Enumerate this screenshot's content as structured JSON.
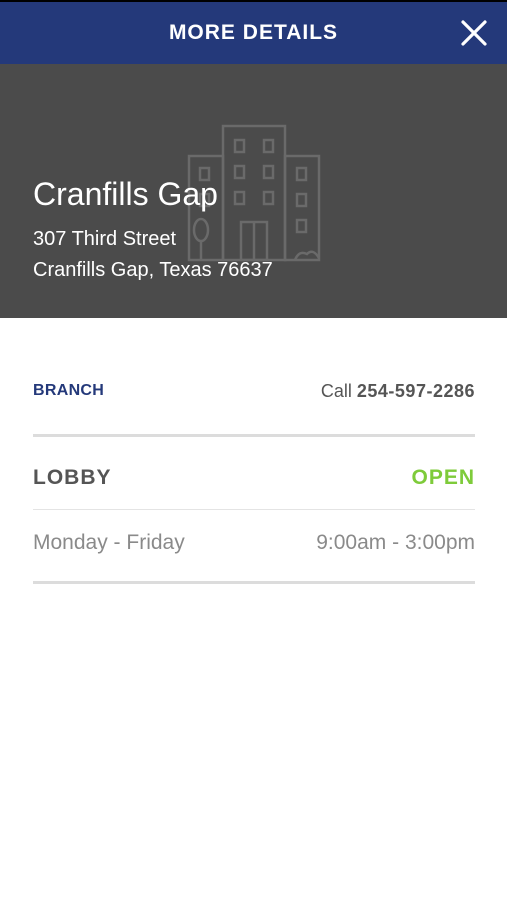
{
  "header": {
    "title": "MORE DETAILS",
    "close_icon": "close-icon"
  },
  "hero": {
    "background_icon": "building-icon",
    "branch_name": "Cranfills Gap",
    "address_line1": "307 Third Street",
    "address_line2": "Cranfills Gap, Texas 76637"
  },
  "branch": {
    "label": "BRANCH",
    "call_prefix": "Call",
    "phone": "254-597-2286"
  },
  "lobby": {
    "label": "LOBBY",
    "status": "OPEN",
    "days": "Monday - Friday",
    "hours": "9:00am - 3:00pm"
  },
  "colors": {
    "header_bg": "#24397a",
    "hero_bg": "#4b4b4b",
    "open_status": "#7ecb3a",
    "branch_label": "#24397a"
  }
}
